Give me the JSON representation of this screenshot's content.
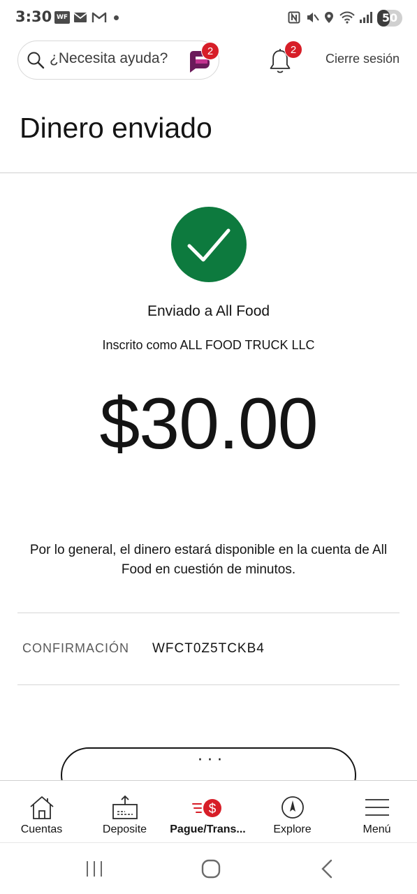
{
  "status_bar": {
    "time": "3:30",
    "wf_icon_text": "WF",
    "battery": "50",
    "battery_level": 0.5
  },
  "header": {
    "search_placeholder": "¿Necesita ayuda?",
    "assistant_badge": "2",
    "notifications_badge": "2",
    "signout_label": "Cierre sesión"
  },
  "page": {
    "title": "Dinero enviado"
  },
  "confirmation": {
    "sent_to": "Enviado a All Food",
    "enrolled_as": "Inscrito como ALL FOOD TRUCK LLC",
    "amount": "$30.00",
    "availability_note": "Por lo general, el dinero estará disponible en la cuenta de All Food en cuestión de minutos.",
    "confirmation_label": "CONFIRMACIÓN",
    "confirmation_value": "WFCT0Z5TCKB4",
    "more_button_label": "· · ·"
  },
  "bottom_nav": {
    "items": [
      {
        "label": "Cuentas",
        "icon": "home-icon"
      },
      {
        "label": "Deposite",
        "icon": "deposit-icon"
      },
      {
        "label": "Pague/Trans...",
        "icon": "pay-transfer-icon",
        "active": true
      },
      {
        "label": "Explore",
        "icon": "compass-icon"
      },
      {
        "label": "Menú",
        "icon": "hamburger-menu-icon"
      }
    ]
  },
  "colors": {
    "success_green": "#0d7a3e",
    "badge_red": "#d71e28",
    "assistant_purple": "#6b1a5a"
  }
}
